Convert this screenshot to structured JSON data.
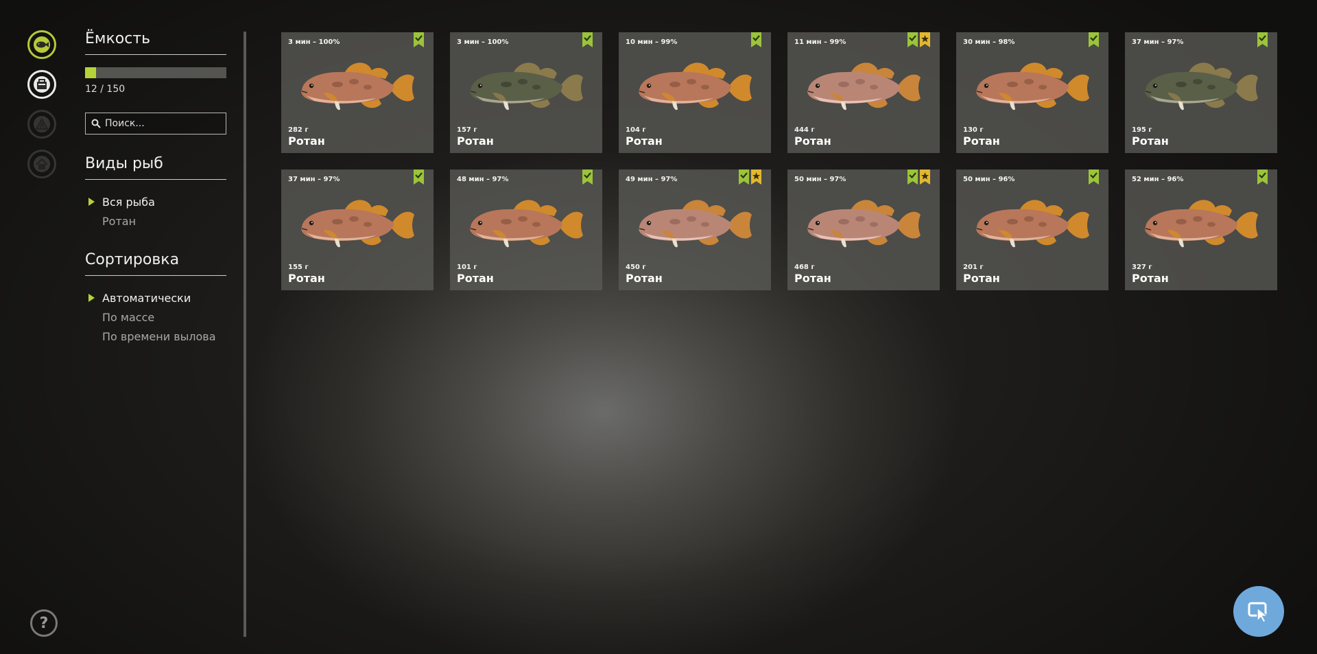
{
  "rail": {
    "icons": [
      "fish-keepnet-icon",
      "tackle-box-icon",
      "tent-icon",
      "home-icon"
    ]
  },
  "panel": {
    "capacity_title": "Ёмкость",
    "capacity_fraction": 0.08,
    "capacity_text": "12 / 150",
    "search_placeholder": "Поиск...",
    "species_title": "Виды рыб",
    "species": [
      "Вся рыба",
      "Ротан"
    ],
    "species_selected": 0,
    "sort_title": "Сортировка",
    "sort_options": [
      "Автоматически",
      "По массе",
      "По времени вылова"
    ],
    "sort_selected": 0
  },
  "colors": {
    "accent_green": "#b6d23a",
    "badge_gold": "#e2b82d",
    "cursor_button": "#6fa9dc"
  },
  "cards": [
    {
      "time": "3 мин – 100%",
      "weight": "282 г",
      "name": "Ротан",
      "fish_color": "orange",
      "trophy": false
    },
    {
      "time": "3 мин – 100%",
      "weight": "157 г",
      "name": "Ротан",
      "fish_color": "dark",
      "trophy": false
    },
    {
      "time": "10 мин – 99%",
      "weight": "104 г",
      "name": "Ротан",
      "fish_color": "orange",
      "trophy": false
    },
    {
      "time": "11 мин – 99%",
      "weight": "444 г",
      "name": "Ротан",
      "fish_color": "pink",
      "trophy": true
    },
    {
      "time": "30 мин – 98%",
      "weight": "130 г",
      "name": "Ротан",
      "fish_color": "orange",
      "trophy": false
    },
    {
      "time": "37 мин – 97%",
      "weight": "195 г",
      "name": "Ротан",
      "fish_color": "dark",
      "trophy": false
    },
    {
      "time": "37 мин – 97%",
      "weight": "155 г",
      "name": "Ротан",
      "fish_color": "orange",
      "trophy": false
    },
    {
      "time": "48 мин – 97%",
      "weight": "101 г",
      "name": "Ротан",
      "fish_color": "orange",
      "trophy": false
    },
    {
      "time": "49 мин – 97%",
      "weight": "450 г",
      "name": "Ротан",
      "fish_color": "pink",
      "trophy": true
    },
    {
      "time": "50 мин – 97%",
      "weight": "468 г",
      "name": "Ротан",
      "fish_color": "pink",
      "trophy": true
    },
    {
      "time": "50 мин – 96%",
      "weight": "201 г",
      "name": "Ротан",
      "fish_color": "orange",
      "trophy": false
    },
    {
      "time": "52 мин – 96%",
      "weight": "327 г",
      "name": "Ротан",
      "fish_color": "orange",
      "trophy": false
    }
  ],
  "help_label": "?"
}
